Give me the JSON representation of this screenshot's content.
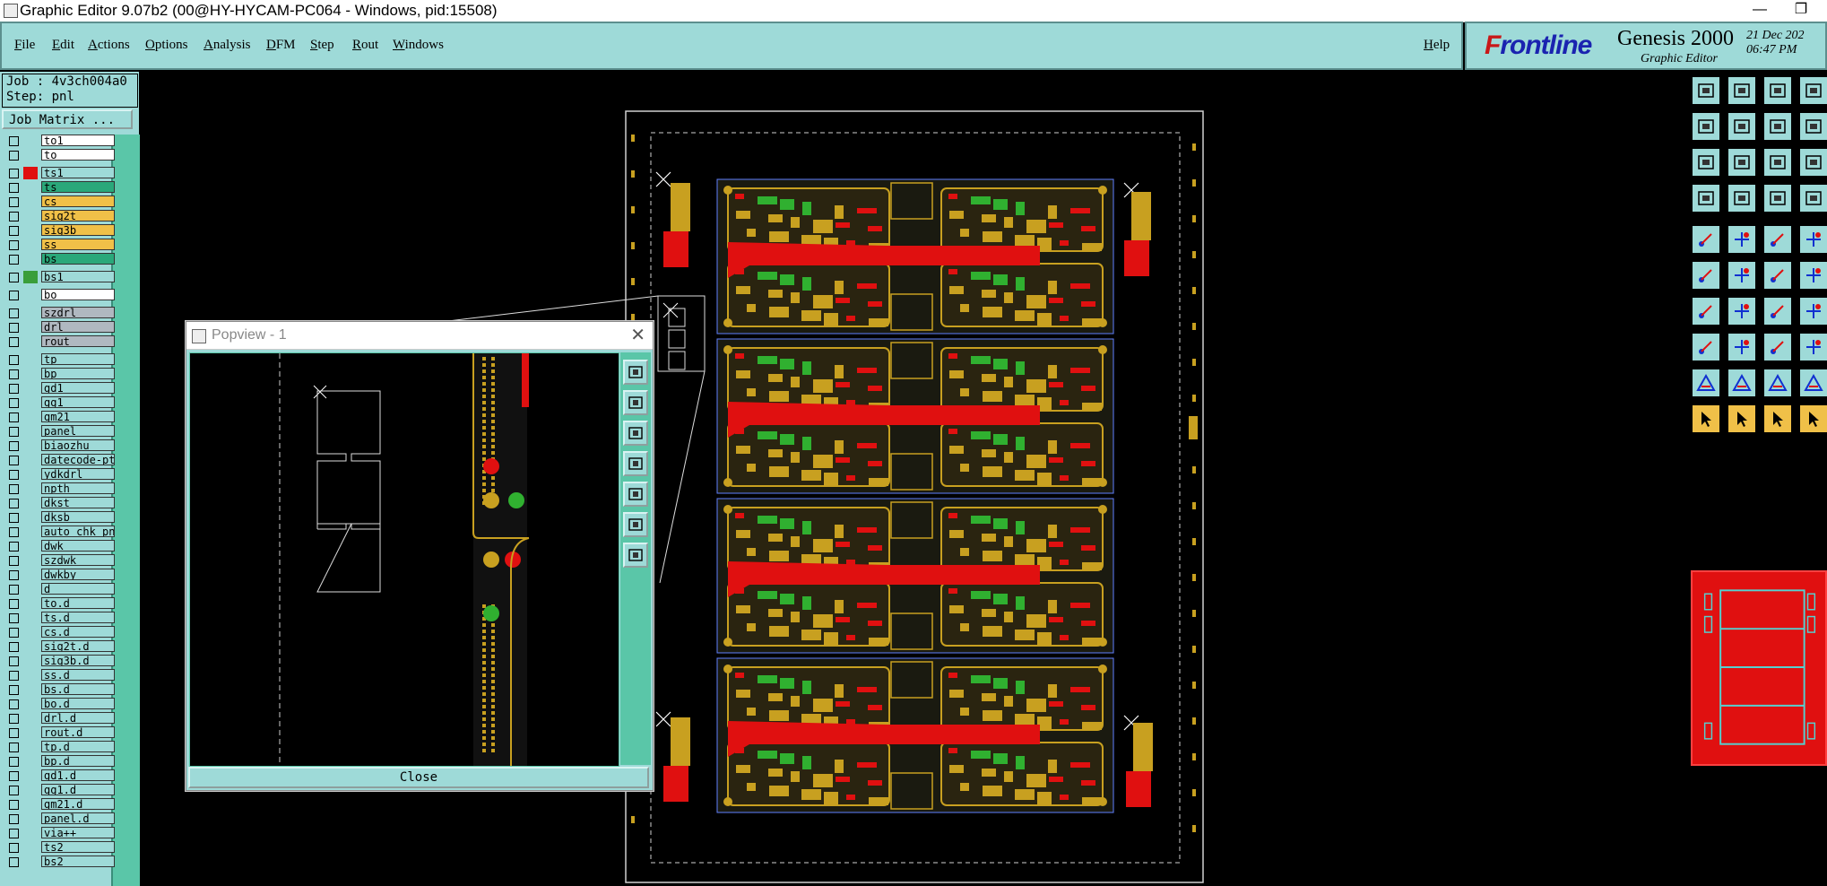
{
  "window": {
    "title": "Graphic Editor 9.07b2 (00@HY-HYCAM-PC064 - Windows, pid:15508)",
    "minimize_glyph": "—",
    "restore_glyph": "❐"
  },
  "menu": {
    "items": [
      "File",
      "Edit",
      "Actions",
      "Options",
      "Analysis",
      "DFM",
      "Step",
      "Rout",
      "Windows"
    ],
    "help": "Help"
  },
  "brand": {
    "logo_part1": "F",
    "logo_part2": "rontline",
    "product": "Genesis 2000",
    "subtitle": "Graphic Editor",
    "date": "21 Dec 202",
    "time": "06:47 PM"
  },
  "job": {
    "job_line": "Job : 4v3ch004a0",
    "step_line": "Step: pnl",
    "matrix_button": "Job Matrix ..."
  },
  "layers": [
    {
      "name": "to1",
      "color": "#ffffff",
      "swatch": "",
      "bg": "#ffffff"
    },
    {
      "name": "to",
      "color": "#ffffff",
      "swatch": "",
      "bg": "#ffffff"
    },
    {
      "name": "ts1",
      "color": "#9edad8",
      "swatch": "#e01010",
      "bg": "#9edad8"
    },
    {
      "name": "ts",
      "color": "#2aa87a",
      "swatch": "",
      "bg": "#2aa87a"
    },
    {
      "name": "cs",
      "color": "#f0c048",
      "swatch": "",
      "bg": "#f0c048"
    },
    {
      "name": "sig2t",
      "color": "#f0c048",
      "swatch": "",
      "bg": "#f0c048"
    },
    {
      "name": "sig3b",
      "color": "#f0c048",
      "swatch": "",
      "bg": "#f0c048"
    },
    {
      "name": "ss",
      "color": "#f0c048",
      "swatch": "",
      "bg": "#f0c048"
    },
    {
      "name": "bs",
      "color": "#2aa87a",
      "swatch": "",
      "bg": "#2aa87a"
    },
    {
      "name": "bs1",
      "color": "#9edad8",
      "swatch": "#3a9e3a",
      "bg": "#9edad8"
    },
    {
      "name": "bo",
      "color": "#ffffff",
      "swatch": "",
      "bg": "#ffffff"
    },
    {
      "name": "szdrl",
      "color": "#b0b8c0",
      "swatch": "",
      "bg": "#b0b8c0"
    },
    {
      "name": "drl",
      "color": "#b0b8c0",
      "swatch": "",
      "bg": "#b0b8c0"
    },
    {
      "name": "rout",
      "color": "#b0b8c0",
      "swatch": "",
      "bg": "#b0b8c0"
    },
    {
      "name": "tp",
      "color": "#9edad8",
      "swatch": "",
      "bg": "#9edad8"
    },
    {
      "name": "bp",
      "color": "#9edad8",
      "swatch": "",
      "bg": "#9edad8"
    },
    {
      "name": "gd1",
      "color": "#9edad8",
      "swatch": "",
      "bg": "#9edad8"
    },
    {
      "name": "gg1",
      "color": "#9edad8",
      "swatch": "",
      "bg": "#9edad8"
    },
    {
      "name": "gm21",
      "color": "#9edad8",
      "swatch": "",
      "bg": "#9edad8"
    },
    {
      "name": "panel",
      "color": "#9edad8",
      "swatch": "",
      "bg": "#9edad8"
    },
    {
      "name": "biaozhu",
      "color": "#9edad8",
      "swatch": "",
      "bg": "#9edad8"
    },
    {
      "name": "datecode-pte",
      "color": "#9edad8",
      "swatch": "",
      "bg": "#9edad8"
    },
    {
      "name": "ydkdrl",
      "color": "#9edad8",
      "swatch": "",
      "bg": "#9edad8"
    },
    {
      "name": "npth",
      "color": "#9edad8",
      "swatch": "",
      "bg": "#9edad8"
    },
    {
      "name": "dkst",
      "color": "#9edad8",
      "swatch": "",
      "bg": "#9edad8"
    },
    {
      "name": "dksb",
      "color": "#9edad8",
      "swatch": "",
      "bg": "#9edad8"
    },
    {
      "name": "auto_chk_pn_",
      "color": "#9edad8",
      "swatch": "",
      "bg": "#9edad8"
    },
    {
      "name": "dwk",
      "color": "#9edad8",
      "swatch": "",
      "bg": "#9edad8"
    },
    {
      "name": "szdwk",
      "color": "#9edad8",
      "swatch": "",
      "bg": "#9edad8"
    },
    {
      "name": "dwkby",
      "color": "#9edad8",
      "swatch": "",
      "bg": "#9edad8"
    },
    {
      "name": "d",
      "color": "#9edad8",
      "swatch": "",
      "bg": "#9edad8"
    },
    {
      "name": "to.d",
      "color": "#9edad8",
      "swatch": "",
      "bg": "#9edad8"
    },
    {
      "name": "ts.d",
      "color": "#9edad8",
      "swatch": "",
      "bg": "#9edad8"
    },
    {
      "name": "cs.d",
      "color": "#9edad8",
      "swatch": "",
      "bg": "#9edad8"
    },
    {
      "name": "sig2t.d",
      "color": "#9edad8",
      "swatch": "",
      "bg": "#9edad8"
    },
    {
      "name": "sig3b.d",
      "color": "#9edad8",
      "swatch": "",
      "bg": "#9edad8"
    },
    {
      "name": "ss.d",
      "color": "#9edad8",
      "swatch": "",
      "bg": "#9edad8"
    },
    {
      "name": "bs.d",
      "color": "#9edad8",
      "swatch": "",
      "bg": "#9edad8"
    },
    {
      "name": "bo.d",
      "color": "#9edad8",
      "swatch": "",
      "bg": "#9edad8"
    },
    {
      "name": "drl.d",
      "color": "#9edad8",
      "swatch": "",
      "bg": "#9edad8"
    },
    {
      "name": "rout.d",
      "color": "#9edad8",
      "swatch": "",
      "bg": "#9edad8"
    },
    {
      "name": "tp.d",
      "color": "#9edad8",
      "swatch": "",
      "bg": "#9edad8"
    },
    {
      "name": "bp.d",
      "color": "#9edad8",
      "swatch": "",
      "bg": "#9edad8"
    },
    {
      "name": "gd1.d",
      "color": "#9edad8",
      "swatch": "",
      "bg": "#9edad8"
    },
    {
      "name": "gg1.d",
      "color": "#9edad8",
      "swatch": "",
      "bg": "#9edad8"
    },
    {
      "name": "gm21.d",
      "color": "#9edad8",
      "swatch": "",
      "bg": "#9edad8"
    },
    {
      "name": "panel.d",
      "color": "#9edad8",
      "swatch": "",
      "bg": "#9edad8"
    },
    {
      "name": "via++",
      "color": "#9edad8",
      "swatch": "",
      "bg": "#9edad8"
    },
    {
      "name": "ts2",
      "color": "#9edad8",
      "swatch": "",
      "bg": "#9edad8"
    },
    {
      "name": "bs2",
      "color": "#9edad8",
      "swatch": "",
      "bg": "#9edad8"
    }
  ],
  "popview": {
    "title": "Popview - 1",
    "close_glyph": "✕",
    "close_button": "Close"
  },
  "pcb_colors": {
    "copper": "#c8a020",
    "trace": "#e01010",
    "silk": "#30b030",
    "outline": "#ffffff",
    "board": "#3a3a30"
  },
  "right_toolbar": {
    "icons": [
      "save-icon",
      "print-icon",
      "home-icon",
      "window-icon",
      "back-icon",
      "forward-icon",
      "step-icon",
      "multi-window-icon",
      "zoom-fit-icon",
      "zoom-home-icon",
      "scale-icon",
      "help-icon",
      "measure-icon",
      "grid-icon",
      "layers-icon",
      "snap-icon",
      "pad-icon",
      "polygon-icon",
      "ruler-icon",
      "dot-icon",
      "node-icon",
      "cross-icon",
      "route-icon",
      "connect-icon",
      "line-icon",
      "slash-icon",
      "arc-icon",
      "text-icon",
      "pad-add-icon",
      "minus-icon",
      "frame-icon",
      "group-icon",
      "triangle-icon",
      "triangle-outline-icon",
      "triangle-a-icon",
      "triangle-b-icon",
      "select-icon",
      "select-filter-icon",
      "select-add-icon",
      "select-all-icon"
    ]
  }
}
